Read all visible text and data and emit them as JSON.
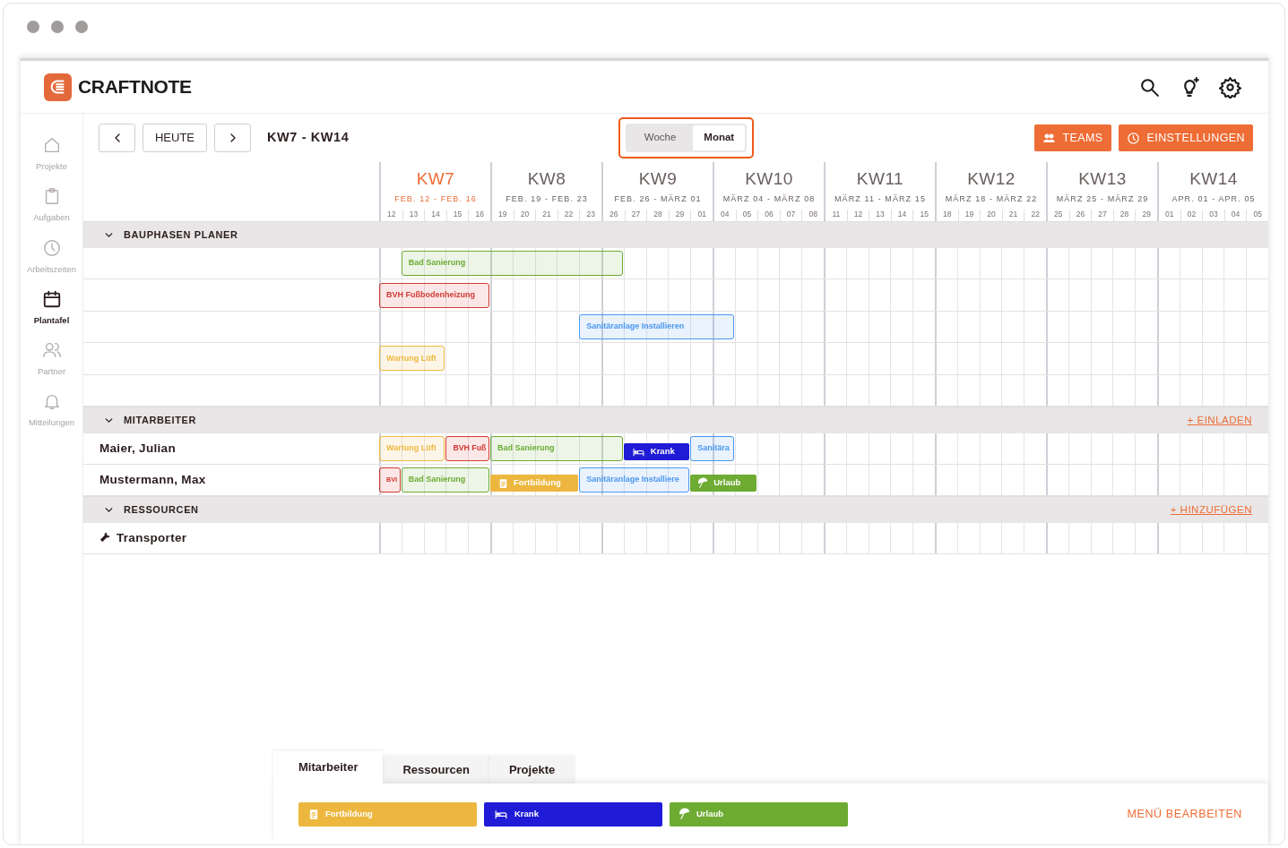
{
  "app": {
    "logo_text": "CRAFTNOTE"
  },
  "sidebar": {
    "items": [
      {
        "label": "Projekte",
        "selected": false
      },
      {
        "label": "Aufgaben",
        "selected": false
      },
      {
        "label": "Arbeitszeiten",
        "selected": false
      },
      {
        "label": "Plantafel",
        "selected": true
      },
      {
        "label": "Partner",
        "selected": false
      },
      {
        "label": "Mitteilungen",
        "selected": false
      }
    ]
  },
  "toolbar": {
    "today_button": "HEUTE",
    "range": "KW7 - KW14",
    "view_toggle": [
      {
        "label": "Woche",
        "selected": false
      },
      {
        "label": "Monat",
        "selected": true
      }
    ],
    "buttons": [
      "TEAMS",
      "EINSTELLUNGEN"
    ]
  },
  "weeks": [
    {
      "label": "KW7",
      "dates": "FEB. 12 - FEB. 16",
      "current": true,
      "days": [
        "12",
        "13",
        "14",
        "15",
        "16"
      ]
    },
    {
      "label": "KW8",
      "dates": "FEB. 19 - FEB. 23",
      "current": false,
      "days": [
        "19",
        "20",
        "21",
        "22",
        "23"
      ]
    },
    {
      "label": "KW9",
      "dates": "FEB. 26 - MÄRZ 01",
      "current": false,
      "days": [
        "26",
        "27",
        "28",
        "29",
        "01"
      ]
    },
    {
      "label": "KW10",
      "dates": "MÄRZ 04 - MÄRZ 08",
      "current": false,
      "days": [
        "04",
        "05",
        "06",
        "07",
        "08"
      ]
    },
    {
      "label": "KW11",
      "dates": "MÄRZ 11 - MÄRZ 15",
      "current": false,
      "days": [
        "11",
        "12",
        "13",
        "14",
        "15"
      ]
    },
    {
      "label": "KW12",
      "dates": "MÄRZ 18 - MÄRZ 22",
      "current": false,
      "days": [
        "18",
        "19",
        "20",
        "21",
        "22"
      ]
    },
    {
      "label": "KW13",
      "dates": "MÄRZ 25 - MÄRZ 29",
      "current": false,
      "days": [
        "25",
        "26",
        "27",
        "28",
        "29"
      ]
    },
    {
      "label": "KW14",
      "dates": "APR. 01 - APR. 05",
      "current": false,
      "days": [
        "01",
        "02",
        "03",
        "04",
        "05"
      ]
    }
  ],
  "sections": [
    {
      "title": "BAUPHASEN PLANER",
      "expanded": true,
      "rows": [
        {
          "bars": [
            {
              "label": "Bad Sanierung",
              "kind": "project",
              "color": "#6aab34"
            }
          ]
        },
        {
          "bars": [
            {
              "label": "BVH Fußbodenheizung",
              "kind": "project",
              "color": "#d23a35"
            }
          ]
        },
        {
          "bars": [
            {
              "label": "Sanitäranlage Installieren",
              "kind": "project",
              "color": "#4a97ef"
            }
          ]
        },
        {
          "bars": [
            {
              "label": "Wartung Lüft",
              "kind": "project",
              "color": "#efb83e"
            }
          ]
        },
        {}
      ]
    },
    {
      "title": "MITARBEITER",
      "expanded": true,
      "action": "+ EINLADEN",
      "rows": [
        {
          "label": "Maier, Julian",
          "kind": "person",
          "bars": [
            {
              "label": "Wartung Lüft",
              "kind": "project",
              "color": "#efb83e"
            },
            {
              "label": "BVH Fuß",
              "kind": "project",
              "color": "#d23a35"
            },
            {
              "label": "Bad Sanierung",
              "kind": "project",
              "color": "#6aab34"
            },
            {
              "label": "Krank",
              "kind": "sick",
              "color": "#1f1bd6"
            },
            {
              "label": "Sanitära",
              "kind": "project",
              "color": "#4a97ef"
            }
          ]
        },
        {
          "label": "Mustermann, Max",
          "kind": "person",
          "bars": [
            {
              "label": "BVI",
              "kind": "project",
              "color": "#d23a35"
            },
            {
              "label": "Bad Sanierung",
              "kind": "project",
              "color": "#6aab34"
            },
            {
              "label": "Fortbildung",
              "kind": "training",
              "color": "#edb73f"
            },
            {
              "label": "Sanitäranlage Installiere",
              "kind": "project",
              "color": "#4a97ef"
            },
            {
              "label": "Urlaub",
              "kind": "vacation",
              "color": "#6eab32"
            }
          ]
        }
      ]
    },
    {
      "title": "RESSOURCEN",
      "expanded": true,
      "action": "+ HINZUFÜGEN",
      "rows": [
        {
          "label": "Transporter",
          "kind": "resource"
        }
      ]
    }
  ],
  "bottom": {
    "tabs": [
      {
        "label": "Mitarbeiter",
        "selected": true
      },
      {
        "label": "Ressourcen",
        "selected": false
      },
      {
        "label": "Projekte",
        "selected": false
      }
    ],
    "legend": [
      {
        "label": "Fortbildung",
        "kind": "training",
        "color": "#edb73f"
      },
      {
        "label": "Krank",
        "kind": "sick",
        "color": "#1f1bd6"
      },
      {
        "label": "Urlaub",
        "kind": "vacation",
        "color": "#6eab32"
      }
    ],
    "edit_link": "MENÜ BEARBEITEN"
  }
}
